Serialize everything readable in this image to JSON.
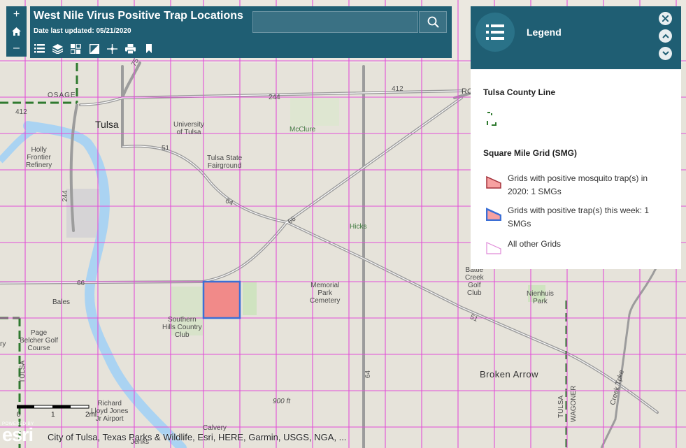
{
  "header": {
    "title": "West Nile Virus Positive Trap Locations",
    "subtitle": "Date last updated: 05/21/2020",
    "search_placeholder": ""
  },
  "zoom": {
    "in": "+",
    "out": "–"
  },
  "toolbar_icons": [
    "list-icon",
    "layers-icon",
    "basemap-icon",
    "overview-icon",
    "measure-icon",
    "print-icon",
    "bookmark-icon"
  ],
  "legend": {
    "title": "Legend",
    "sections": [
      {
        "heading": "Tulsa County Line",
        "items": []
      },
      {
        "heading": "Square Mile Grid (SMG)",
        "items": [
          {
            "label": "Grids with positive mosquito trap(s) in 2020: 1 SMGs",
            "fill": "#f7a1a1",
            "stroke": "#a3303a"
          },
          {
            "label": "Grids with positive trap(s) this week: 1 SMGs",
            "fill": "#f7a1a1",
            "stroke": "#3b6fd6"
          },
          {
            "label": "All other Grids",
            "fill": "#ffffff",
            "stroke": "#e08ad8"
          }
        ]
      }
    ]
  },
  "map_labels": {
    "tulsa": "Tulsa",
    "osage": "OSAGE",
    "university": "University\nof Tulsa",
    "mcclure": "McClure",
    "holly": "Holly\nFrontier\nRefinery",
    "fairground": "Tulsa State\nFairground",
    "hicks": "Hicks",
    "memorial": "Memorial\nPark\nCemetery",
    "battle_creek": "Battle\nCreek\nGolf\nClub",
    "nienhuis": "Nienhuis\nPark",
    "bales": "Bales",
    "southern_hills": "Southern\nHills Country\nClub",
    "page_belcher": "Page\nBelcher Golf\nCourse",
    "broken_arrow": "Broken Arrow",
    "richard_jones": "Richard\nLloyd Jones\nJr Airport",
    "calvery": "Calvery",
    "jenks": "Jenks",
    "ft900": "900 ft",
    "tulsa_county_left": "TULSA",
    "tulsa_county_right": "TULSA",
    "wagoner": "WAGONER",
    "creek_tpke": "Creek Tpke",
    "ro": "RO",
    "ry": "ry",
    "r244a": "244",
    "r244b": "244",
    "r412a": "412",
    "r412b": "412",
    "r51": "51",
    "r64a": "64",
    "r64b": "64",
    "r66a": "66",
    "r66b": "66",
    "r51b": "51",
    "r75": "75"
  },
  "scale": {
    "zero": "0",
    "one": "1",
    "two": "2mi"
  },
  "attribution": "City of Tulsa, Texas Parks & Wildlife, Esri, HERE, Garmin, USGS, NGA, ...",
  "esri": {
    "powered": "POWERED BY",
    "logo": "esri"
  },
  "colors": {
    "header": "#1f5e73",
    "grid": "#e24fd8",
    "highlight_fill": "#f27a7a",
    "highlight_stroke": "#3b6fd6"
  }
}
